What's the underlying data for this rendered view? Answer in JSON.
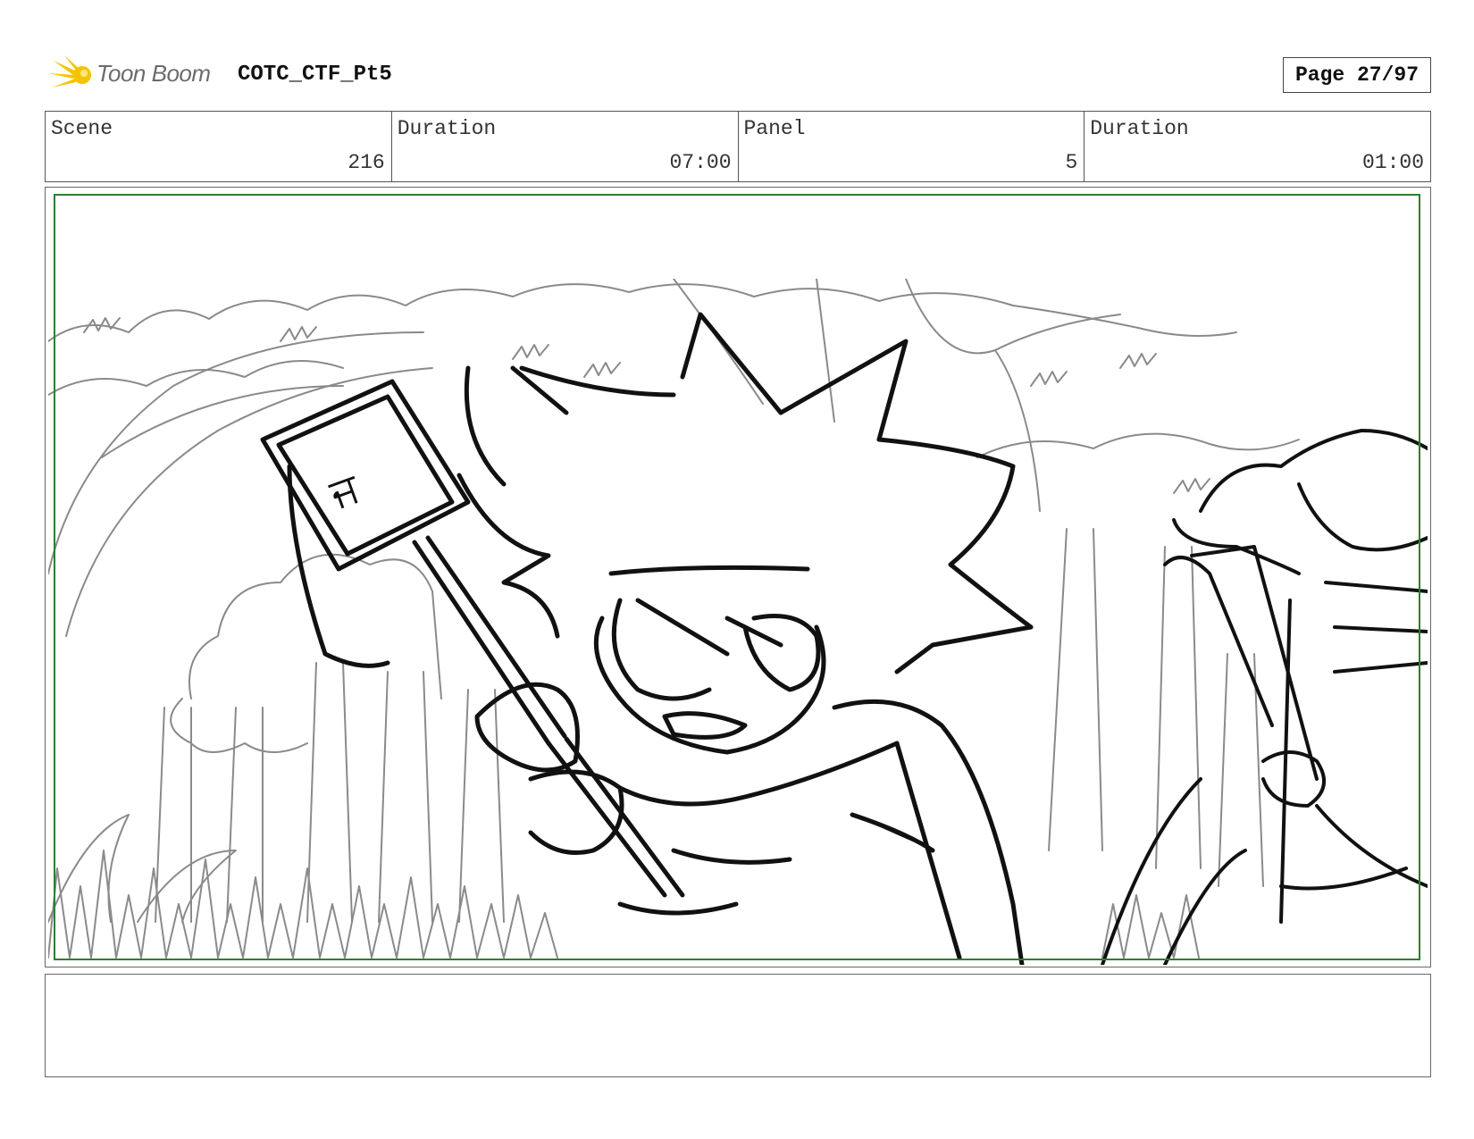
{
  "header": {
    "logo_text": "Toon Boom",
    "project_title": "COTC_CTF_Pt5",
    "page_label": "Page 27/97"
  },
  "info": {
    "scene_label": "Scene",
    "scene_value": "216",
    "scene_duration_label": "Duration",
    "scene_duration_value": "07:00",
    "panel_label": "Panel",
    "panel_value": "5",
    "panel_duration_label": "Duration",
    "panel_duration_value": "01:00"
  },
  "panel": {
    "sign_glyph": "ਜ"
  },
  "notes": {
    "text": ""
  },
  "colors": {
    "logo_yellow": "#f5c400",
    "safe_frame": "#2e7d32"
  }
}
